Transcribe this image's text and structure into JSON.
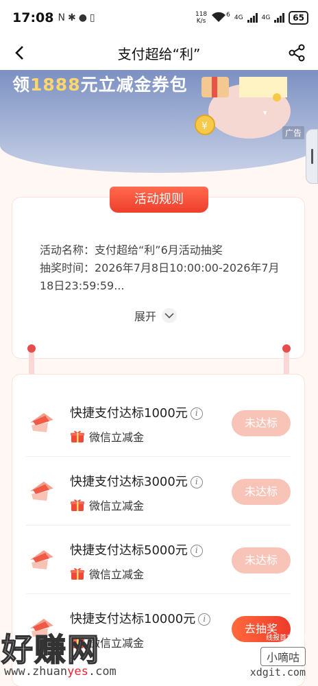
{
  "status_bar": {
    "time": "17:08",
    "net_speed_value": "118",
    "net_speed_unit": "K/s",
    "wifi_sup": "6",
    "sig1": "4G",
    "sig2": "4G",
    "battery": "65"
  },
  "nav": {
    "title": "支付超给“利”",
    "back_icon": "chevron-left-icon",
    "share_icon": "share-icon"
  },
  "banner": {
    "text_prefix": "领",
    "text_highlight": "1888",
    "text_suffix": "元立减金券包",
    "ad_label": "广告"
  },
  "rules": {
    "tab_label": "活动规则",
    "name_line": "活动名称：支付超给“利”6月活动抽奖",
    "time_line": "抽奖时间：2026年7月8日10:00:00-2026年7月18日23:59:59...",
    "expand_label": "展开"
  },
  "tasks": [
    {
      "title": "快捷支付达标1000元",
      "reward": "微信立减金",
      "button": "未达标",
      "active": false
    },
    {
      "title": "快捷支付达标3000元",
      "reward": "微信立减金",
      "button": "未达标",
      "active": false
    },
    {
      "title": "快捷支付达标5000元",
      "reward": "微信立减金",
      "button": "未达标",
      "active": false
    },
    {
      "title": "快捷支付达标10000元",
      "reward": "微信立减金",
      "button": "去抽奖",
      "active": true
    }
  ],
  "watermark": {
    "big": "好赚网",
    "url_a": "www.zhuan",
    "url_b": "yes",
    "url_c": ".com",
    "small_top": "线报首发社区",
    "small_box": "小嘀咕",
    "small_url": "xdgit.com"
  },
  "colors": {
    "accent": "#ee3e2c",
    "button_disabled": "#f9c4b8",
    "banner": "#8a9ccb"
  }
}
